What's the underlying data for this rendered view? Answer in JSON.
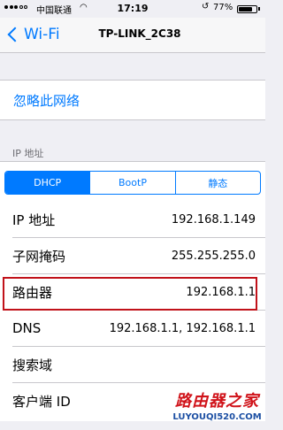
{
  "status_bar": {
    "carrier": "中国联通",
    "wifi_icon": "wifi-icon",
    "time": "17:19",
    "rotation_lock_icon": "rotation-lock-icon",
    "battery_percent": "77%",
    "battery_level": 0.77
  },
  "nav": {
    "back_label": "Wi-Fi",
    "title": "TP-LINK_2C38"
  },
  "forget_label": "忽略此网络",
  "section_header": "IP 地址",
  "segments": {
    "items": [
      "DHCP",
      "BootP",
      "静态"
    ],
    "selected": "DHCP"
  },
  "rows": [
    {
      "label": "IP 地址",
      "value": "192.168.1.149"
    },
    {
      "label": "子网掩码",
      "value": "255.255.255.0"
    },
    {
      "label": "路由器",
      "value": "192.168.1.1"
    },
    {
      "label": "DNS",
      "value": "192.168.1.1, 192.168.1.1"
    },
    {
      "label": "搜索域",
      "value": ""
    },
    {
      "label": "客户端 ID",
      "value": ""
    }
  ],
  "watermark": {
    "main": "路由器之家",
    "sub": "LUYOUQI520.COM"
  },
  "colors": {
    "accent": "#007aff",
    "highlight_border": "#c1121a",
    "background": "#efeff4"
  }
}
